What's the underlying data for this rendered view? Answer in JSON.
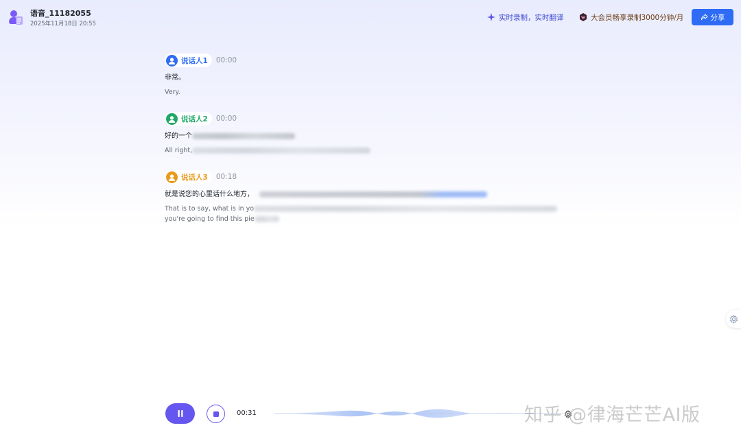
{
  "header": {
    "title": "语音_11182055",
    "datetime": "2025年11月18日 20:55",
    "realtime_label": "实时录制，实时翻译",
    "vip_label": "大会员畅享录制3000分钟/月",
    "share_label": "分享"
  },
  "colors": {
    "accent": "#2e6cf6",
    "player": "#6656f0",
    "speaker1": "#2e6cf6",
    "speaker2": "#20a867",
    "speaker3": "#e99a1b"
  },
  "transcript": {
    "segments": [
      {
        "speaker": "说话人1",
        "time": "00:00",
        "original": "非常。",
        "translation": "Very."
      },
      {
        "speaker": "说话人2",
        "time": "00:00",
        "original": "好的一个",
        "translation": "All right,"
      },
      {
        "speaker": "说话人3",
        "time": "00:18",
        "original": "就是说您的心里话什么地方，",
        "translation_line1": "That is to say, what is in yo",
        "translation_line2": "you're going to find this pie"
      }
    ]
  },
  "player": {
    "elapsed": "00:31",
    "pause_icon": "pause-icon",
    "stop_icon": "stop-icon"
  },
  "watermark": "知乎 @律海芒芒AI版"
}
